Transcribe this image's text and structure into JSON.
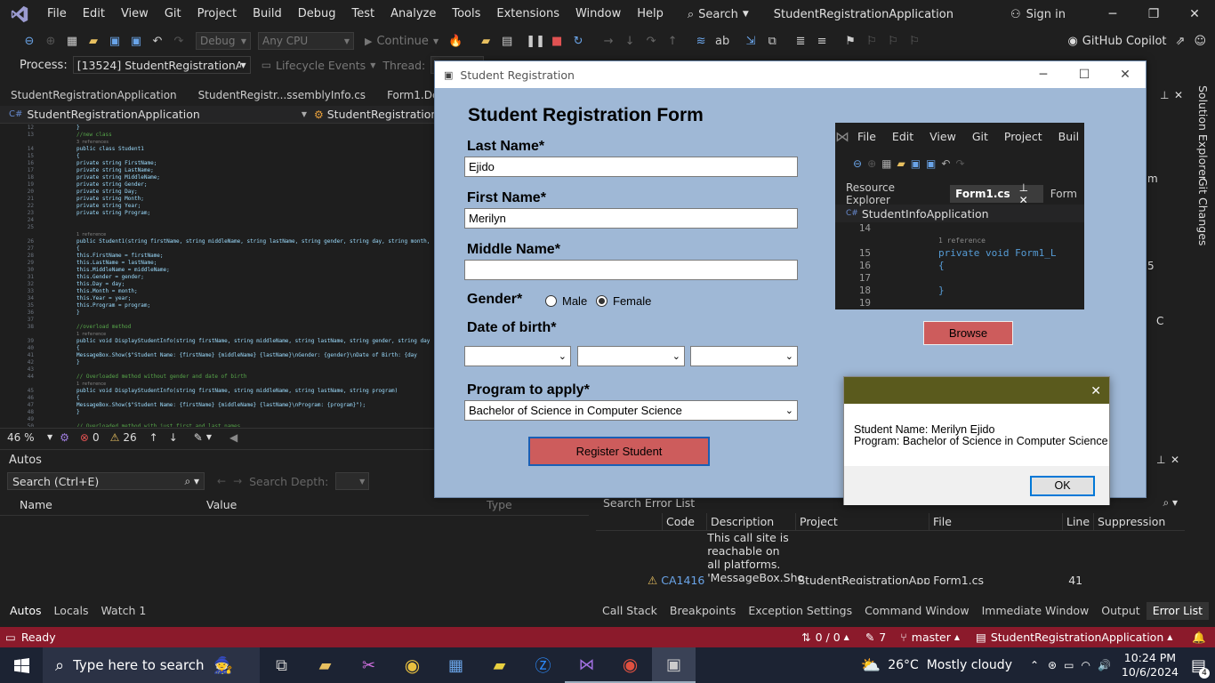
{
  "vs": {
    "menu": [
      "File",
      "Edit",
      "View",
      "Git",
      "Project",
      "Build",
      "Debug",
      "Test",
      "Analyze",
      "Tools",
      "Extensions",
      "Window",
      "Help"
    ],
    "search_label": "Search",
    "solution_title": "StudentRegistrationApplication",
    "signin": "Sign in",
    "copilot": "GitHub Copilot",
    "toolbar": {
      "config": "Debug",
      "platform": "Any CPU",
      "continue": "Continue"
    },
    "toolbar2": {
      "process_label": "Process:",
      "process_value": "[13524] StudentRegistrationApplic",
      "lifecycle": "Lifecycle Events",
      "thread_label": "Thread:"
    },
    "editor_tabs": [
      "StudentRegistrationApplication",
      "StudentRegistr...ssemblyInfo.cs",
      "Form1.De"
    ],
    "editor_nav": "StudentRegistrationApplication",
    "editor_nav2": "StudentRegistrationAppli",
    "code_lines": [
      {
        "n": "12",
        "t": "}"
      },
      {
        "n": "13",
        "t": "//new class"
      },
      {
        "n": "",
        "t": "3 references"
      },
      {
        "n": "14",
        "t": "public class Student1"
      },
      {
        "n": "15",
        "t": "{"
      },
      {
        "n": "16",
        "t": "    private string FirstName;"
      },
      {
        "n": "17",
        "t": "    private string LastName;"
      },
      {
        "n": "18",
        "t": "    private string MiddleName;"
      },
      {
        "n": "19",
        "t": "    private string Gender;"
      },
      {
        "n": "20",
        "t": "    private string Day;"
      },
      {
        "n": "21",
        "t": "    private string Month;"
      },
      {
        "n": "22",
        "t": "    private string Year;"
      },
      {
        "n": "23",
        "t": "    private string Program;"
      },
      {
        "n": "24",
        "t": ""
      },
      {
        "n": "25",
        "t": ""
      },
      {
        "n": "",
        "t": "    1 reference"
      },
      {
        "n": "26",
        "t": "    public Student1(string firstName, string middleName, string lastName, string gender, string day, string month,"
      },
      {
        "n": "27",
        "t": "    {"
      },
      {
        "n": "28",
        "t": "        this.FirstName = firstName;"
      },
      {
        "n": "29",
        "t": "        this.LastName = lastName;"
      },
      {
        "n": "30",
        "t": "        this.MiddleName = middleName;"
      },
      {
        "n": "31",
        "t": "        this.Gender = gender;"
      },
      {
        "n": "32",
        "t": "        this.Day = day;"
      },
      {
        "n": "33",
        "t": "        this.Month = month;"
      },
      {
        "n": "34",
        "t": "        this.Year = year;"
      },
      {
        "n": "35",
        "t": "        this.Program = program;"
      },
      {
        "n": "36",
        "t": "    }"
      },
      {
        "n": "37",
        "t": ""
      },
      {
        "n": "38",
        "t": "    //overload method"
      },
      {
        "n": "",
        "t": "    1 reference"
      },
      {
        "n": "39",
        "t": "    public void DisplayStudentInfo(string firstName, string middleName, string lastName, string gender, string day"
      },
      {
        "n": "40",
        "t": "    {"
      },
      {
        "n": "41",
        "t": "        MessageBox.Show($\"Student Name: {firstName} {middleName} {lastName}\\nGender: {gender}\\nDate of Birth: {day"
      },
      {
        "n": "42",
        "t": "    }"
      },
      {
        "n": "43",
        "t": ""
      },
      {
        "n": "44",
        "t": "    // Overloaded method without gender and date of birth"
      },
      {
        "n": "",
        "t": "    1 reference"
      },
      {
        "n": "45",
        "t": "    public void DisplayStudentInfo(string firstName, string middleName, string lastName, string program)"
      },
      {
        "n": "46",
        "t": "    {"
      },
      {
        "n": "47",
        "t": "        MessageBox.Show($\"Student Name: {firstName} {middleName} {lastName}\\nProgram: {program}\");"
      },
      {
        "n": "48",
        "t": "    }"
      },
      {
        "n": "49",
        "t": ""
      },
      {
        "n": "50",
        "t": "    // Overloaded method with just first and last names"
      }
    ],
    "zoom": "46 %",
    "errors": "0",
    "warnings": "26",
    "autos": {
      "title": "Autos",
      "search_placeholder": "Search (Ctrl+E)",
      "search_depth": "Search Depth:",
      "cols": [
        "Name",
        "Value",
        "Type"
      ]
    },
    "bottom_tabs_left": [
      "Autos",
      "Locals",
      "Watch 1"
    ],
    "bottom_tabs_right": [
      "Call Stack",
      "Breakpoints",
      "Exception Settings",
      "Command Window",
      "Immediate Window",
      "Output",
      "Error List"
    ],
    "error_list": {
      "search": "Search Error List",
      "cols": [
        "Code",
        "Description",
        "Project",
        "File",
        "Line",
        "Suppression Sta"
      ],
      "row": {
        "code": "CA1416",
        "description": "This call site is reachable on all platforms. 'MessageBox.Sho",
        "project": "StudentRegistrationApplic",
        "file": "Form1.cs",
        "line": "41"
      }
    },
    "side_tabs": [
      "Solution Explorer",
      "Git Changes"
    ],
    "side_fragments": [
      "m",
      "5",
      "C"
    ],
    "status": {
      "ready": "Ready",
      "sync": "0 / 0",
      "edits": "7",
      "branch": "master",
      "repo": "StudentRegistrationApplication"
    }
  },
  "form": {
    "window_title": "Student Registration",
    "title": "Student Registration Form",
    "last_name_label": "Last Name*",
    "last_name_value": "Ejido",
    "first_name_label": "First Name*",
    "first_name_value": "Merilyn",
    "middle_name_label": "Middle Name*",
    "middle_name_value": "",
    "gender_label": "Gender*",
    "male": "Male",
    "female": "Female",
    "gender_selected": "Female",
    "dob_label": "Date of birth*",
    "program_label": "Program to apply*",
    "program_value": "Bachelor of Science in Computer Science",
    "register": "Register Student",
    "browse": "Browse"
  },
  "preview": {
    "menu": [
      "File",
      "Edit",
      "View",
      "Git",
      "Project",
      "Buil"
    ],
    "tabs": [
      "Resource Explorer",
      "Form1.cs",
      "Form"
    ],
    "nav": "StudentInfoApplication",
    "lines": [
      {
        "n": "14",
        "t": ""
      },
      {
        "n": "",
        "t": "1 reference"
      },
      {
        "n": "15",
        "t": "private void Form1_L"
      },
      {
        "n": "16",
        "t": "{"
      },
      {
        "n": "17",
        "t": ""
      },
      {
        "n": "18",
        "t": "}"
      },
      {
        "n": "19",
        "t": ""
      },
      {
        "n": "",
        "t": "1 reference"
      }
    ]
  },
  "msgbox": {
    "line1": "Student Name: Merilyn Ejido",
    "line2": "Program: Bachelor of Science in Computer Science",
    "ok": "OK"
  },
  "taskbar": {
    "search_placeholder": "Type here to search",
    "weather": "26°C  Mostly cloudy",
    "time": "10:24 PM",
    "date": "10/6/2024",
    "notifications": "4"
  }
}
